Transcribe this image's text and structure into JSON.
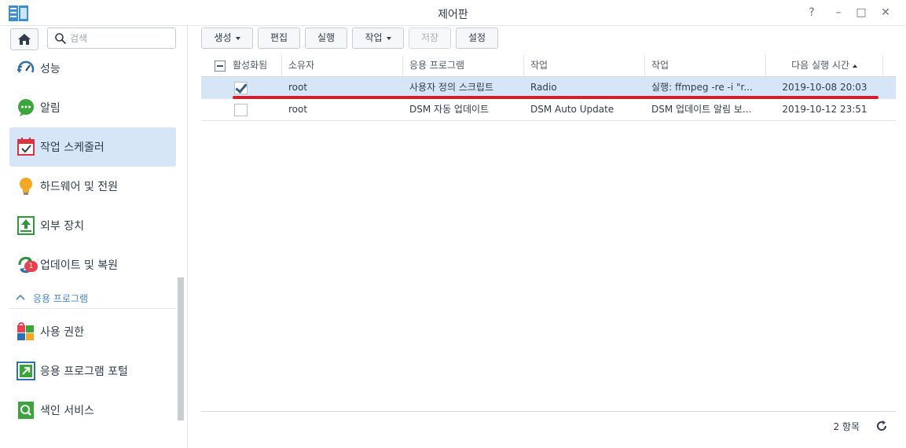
{
  "window": {
    "title": "제어판",
    "help_glyph": "?",
    "minimize_glyph": "–",
    "maximize_glyph": "□",
    "close_glyph": "✕"
  },
  "sidebar": {
    "search_placeholder": "검색",
    "items": [
      {
        "label": "성능",
        "icon": "performance-gauge-icon"
      },
      {
        "label": "알림",
        "icon": "notification-bubble-icon"
      },
      {
        "label": "작업 스케줄러",
        "icon": "calendar-check-icon",
        "active": true
      },
      {
        "label": "하드웨어 및 전원",
        "icon": "lightbulb-icon"
      },
      {
        "label": "외부 장치",
        "icon": "external-device-upload-icon"
      },
      {
        "label": "업데이트 및 복원",
        "icon": "update-restore-icon",
        "badge": "1"
      }
    ],
    "section_label": "응용 프로그램",
    "app_items": [
      {
        "label": "사용 권한",
        "icon": "privileges-lock-icon"
      },
      {
        "label": "응용 프로그램 포털",
        "icon": "app-portal-arrow-icon"
      },
      {
        "label": "색인 서비스",
        "icon": "indexing-search-icon"
      }
    ]
  },
  "toolbar": {
    "create": "생성",
    "edit": "편집",
    "run": "실행",
    "action": "작업",
    "save": "저장",
    "settings": "설정"
  },
  "grid": {
    "headers": {
      "enabled": "활성화됨",
      "owner": "소유자",
      "application": "응용 프로그램",
      "task": "작업",
      "action": "작업",
      "next_run": "다음 실행 시간"
    },
    "rows": [
      {
        "enabled": true,
        "owner": "root",
        "application": "사용자 정의 스크립트",
        "task": "Radio",
        "action": "실행: ffmpeg -re -i \"r...",
        "next_run": "2019-10-08 20:03"
      },
      {
        "enabled": false,
        "owner": "root",
        "application": "DSM 자동 업데이트",
        "task": "DSM Auto Update",
        "action": "DSM 업데이트 알림 보...",
        "next_run": "2019-10-12 23:51"
      }
    ]
  },
  "footer": {
    "count": "2 항목"
  },
  "colors": {
    "accent": "#d7e6f6",
    "highlight": "#d21f2f",
    "badge": "#e8404c"
  }
}
